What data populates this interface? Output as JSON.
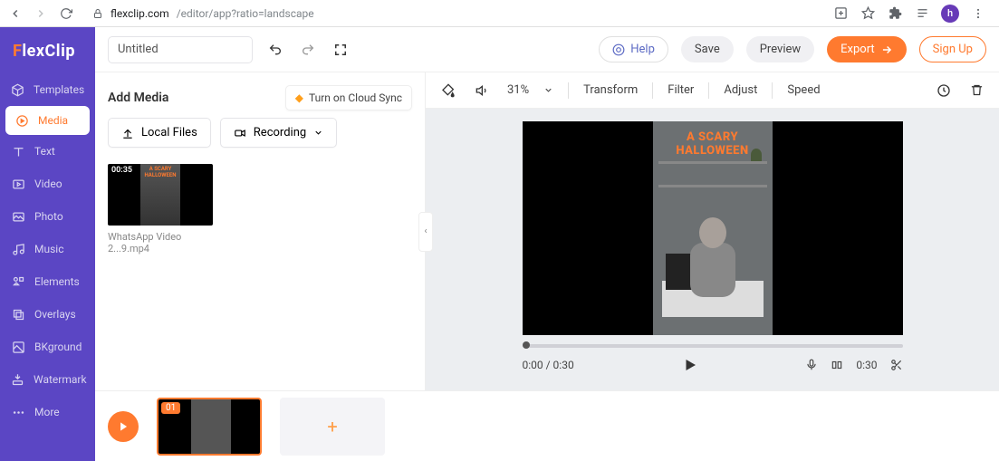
{
  "browser": {
    "url_host": "flexclip.com",
    "url_path": "/editor/app?ratio=landscape",
    "profile_initial": "h"
  },
  "logo": {
    "f": "F",
    "rest": "lexClip"
  },
  "sidebar": {
    "items": [
      {
        "label": "Templates"
      },
      {
        "label": "Media"
      },
      {
        "label": "Text"
      },
      {
        "label": "Video"
      },
      {
        "label": "Photo"
      },
      {
        "label": "Music"
      },
      {
        "label": "Elements"
      },
      {
        "label": "Overlays"
      },
      {
        "label": "BKground"
      },
      {
        "label": "Watermark"
      },
      {
        "label": "More"
      }
    ]
  },
  "topbar": {
    "title_value": "Untitled",
    "help": "Help",
    "save": "Save",
    "preview": "Preview",
    "export": "Export",
    "signup": "Sign Up"
  },
  "media_panel": {
    "heading": "Add Media",
    "cloud_sync": "Turn on Cloud Sync",
    "local_files": "Local Files",
    "recording": "Recording",
    "thumb_duration": "00:35",
    "thumb_name": "WhatsApp Video 2...9.mp4",
    "thumb_overlay": "A SCARY HALLOWEEN"
  },
  "preview_toolbar": {
    "zoom": "31%",
    "transform": "Transform",
    "filter": "Filter",
    "adjust": "Adjust",
    "speed": "Speed"
  },
  "video_overlay": {
    "line1": "A SCARY",
    "line2": "HALLOWEEN"
  },
  "player": {
    "time": "0:00 / 0:30",
    "duration_right": "0:30"
  },
  "timeline": {
    "clip_number": "01"
  }
}
